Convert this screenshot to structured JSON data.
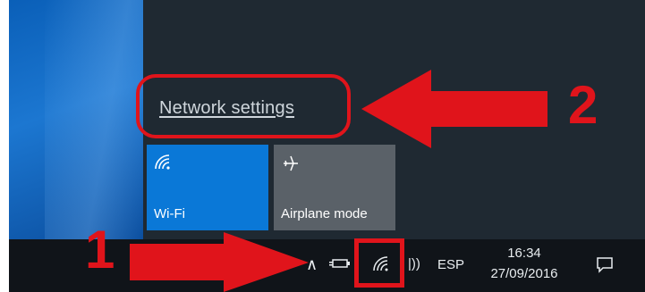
{
  "flyout": {
    "network_settings_label": "Network settings",
    "tiles": [
      {
        "label": "Wi-Fi",
        "icon": "wifi-icon",
        "state": "on",
        "color": "#0a78d7"
      },
      {
        "label": "Airplane mode",
        "icon": "airplane-icon",
        "state": "off",
        "color": "#5a6168"
      }
    ]
  },
  "taskbar": {
    "language": "ESP",
    "time": "16:34",
    "date": "27/09/2016",
    "icons": [
      "chevron-up-icon",
      "power-plug-icon",
      "wifi-icon",
      "bluetooth-icon",
      "notification-icon"
    ]
  },
  "annotations": {
    "step1": "1",
    "step2": "2",
    "color": "#e0141b"
  }
}
